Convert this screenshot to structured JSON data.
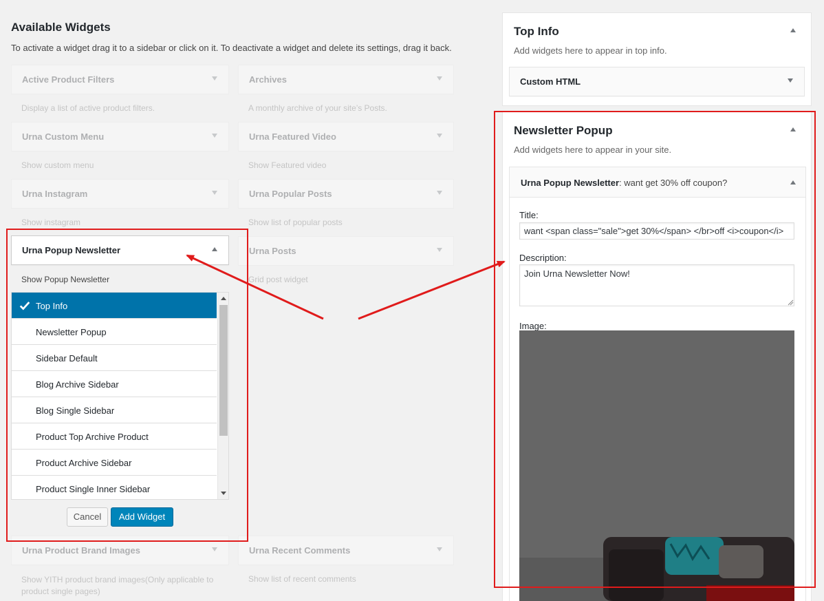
{
  "header": {
    "title": "Available Widgets",
    "description": "To activate a widget drag it to a sidebar or click on it. To deactivate a widget and delete its settings, drag it back."
  },
  "widgets": [
    {
      "name": "Active Product Filters",
      "desc": "Display a list of active product filters."
    },
    {
      "name": "Archives",
      "desc": "A monthly archive of your site’s Posts."
    },
    {
      "name": "Urna Custom Menu",
      "desc": "Show custom menu"
    },
    {
      "name": "Urna Featured Video",
      "desc": "Show Featured video"
    },
    {
      "name": "Urna Instagram",
      "desc": "Show instagram"
    },
    {
      "name": "Urna Popular Posts",
      "desc": "Show list of popular posts"
    },
    {
      "name": "Urna Popup Newsletter",
      "desc": "Show Popup Newsletter"
    },
    {
      "name": "Urna Posts",
      "desc": "Grid post widget"
    },
    {
      "name": "Urna Product Brand Images",
      "desc": "Show YITH product brand images(Only applicable to product single pages)"
    },
    {
      "name": "Urna Recent Comments",
      "desc": "Show list of recent comments"
    }
  ],
  "chooser": {
    "items": [
      "Top Info",
      "Newsletter Popup",
      "Sidebar Default",
      "Blog Archive Sidebar",
      "Blog Single Sidebar",
      "Product Top Archive Product",
      "Product Archive Sidebar",
      "Product Single Inner Sidebar"
    ],
    "selected": "Top Info",
    "cancel_label": "Cancel",
    "add_label": "Add Widget"
  },
  "sidebars": {
    "top_info": {
      "title": "Top Info",
      "desc": "Add widgets here to appear in top info.",
      "widget": "Custom HTML"
    },
    "newsletter_popup": {
      "title": "Newsletter Popup",
      "desc": "Add widgets here to appear in your site.",
      "widget_name": "Urna Popup Newsletter",
      "widget_subtitle": ": want get 30% off coupon?",
      "title_label": "Title:",
      "title_value": "want <span class=\"sale\">get 30%</span> </br>off <i>coupon</i>",
      "description_label": "Description:",
      "description_value": "Join Urna Newsletter Now!",
      "image_label": "Image:"
    }
  },
  "colors": {
    "accent": "#0073aa",
    "button": "#0085ba",
    "annotation": "#e01b1b",
    "background": "#f1f1f1"
  }
}
